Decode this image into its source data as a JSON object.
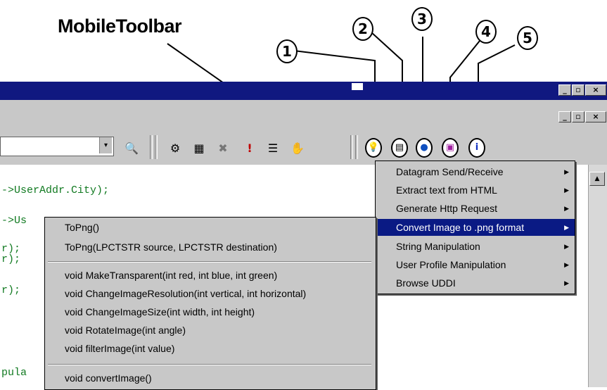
{
  "caption": "MobileToolbar",
  "callouts": [
    "1",
    "2",
    "3",
    "4",
    "5"
  ],
  "window_buttons": [
    "_",
    "▫",
    "×"
  ],
  "combo": {
    "arrow": "▾"
  },
  "toolbar_icons": [
    "find-icon",
    "compile-icon",
    "build-icon",
    "stop-icon",
    "execute-icon",
    "toggle-list-icon",
    "hand-icon"
  ],
  "mobile_toolbar_icons": [
    "lightbulb-icon",
    "page-icon",
    "globe-icon",
    "disk-icon",
    "info-icon"
  ],
  "code_lines": [
    "->UserAddr.City);",
    "->Us",
    "r);",
    "r);",
    "r);",
    "pula"
  ],
  "submenu": {
    "items": [
      {
        "label": "Datagram Send/Receive",
        "has_arrow": true
      },
      {
        "label": "Extract text from HTML",
        "has_arrow": true
      },
      {
        "label": "Generate Http Request",
        "has_arrow": true
      },
      {
        "label": "Convert Image to .png format",
        "has_arrow": true,
        "selected": true
      },
      {
        "label": "String Manipulation",
        "has_arrow": true
      },
      {
        "label": "User Profile Manipulation",
        "has_arrow": true
      },
      {
        "label": "Browse UDDI",
        "has_arrow": true
      }
    ],
    "arrow": "▶"
  },
  "popup": {
    "group1": [
      "ToPng()",
      "ToPng(LPCTSTR source, LPCTSTR destination)"
    ],
    "group2": [
      "void MakeTransparent(int red, int blue, int green)",
      "void ChangeImageResolution(int vertical, int horizontal)",
      "void ChangeImageSize(int width, int height)",
      "void RotateImage(int angle)",
      "void filterImage(int value)"
    ],
    "group3": [
      "void convertImage()"
    ]
  },
  "scroll_up": "▲"
}
